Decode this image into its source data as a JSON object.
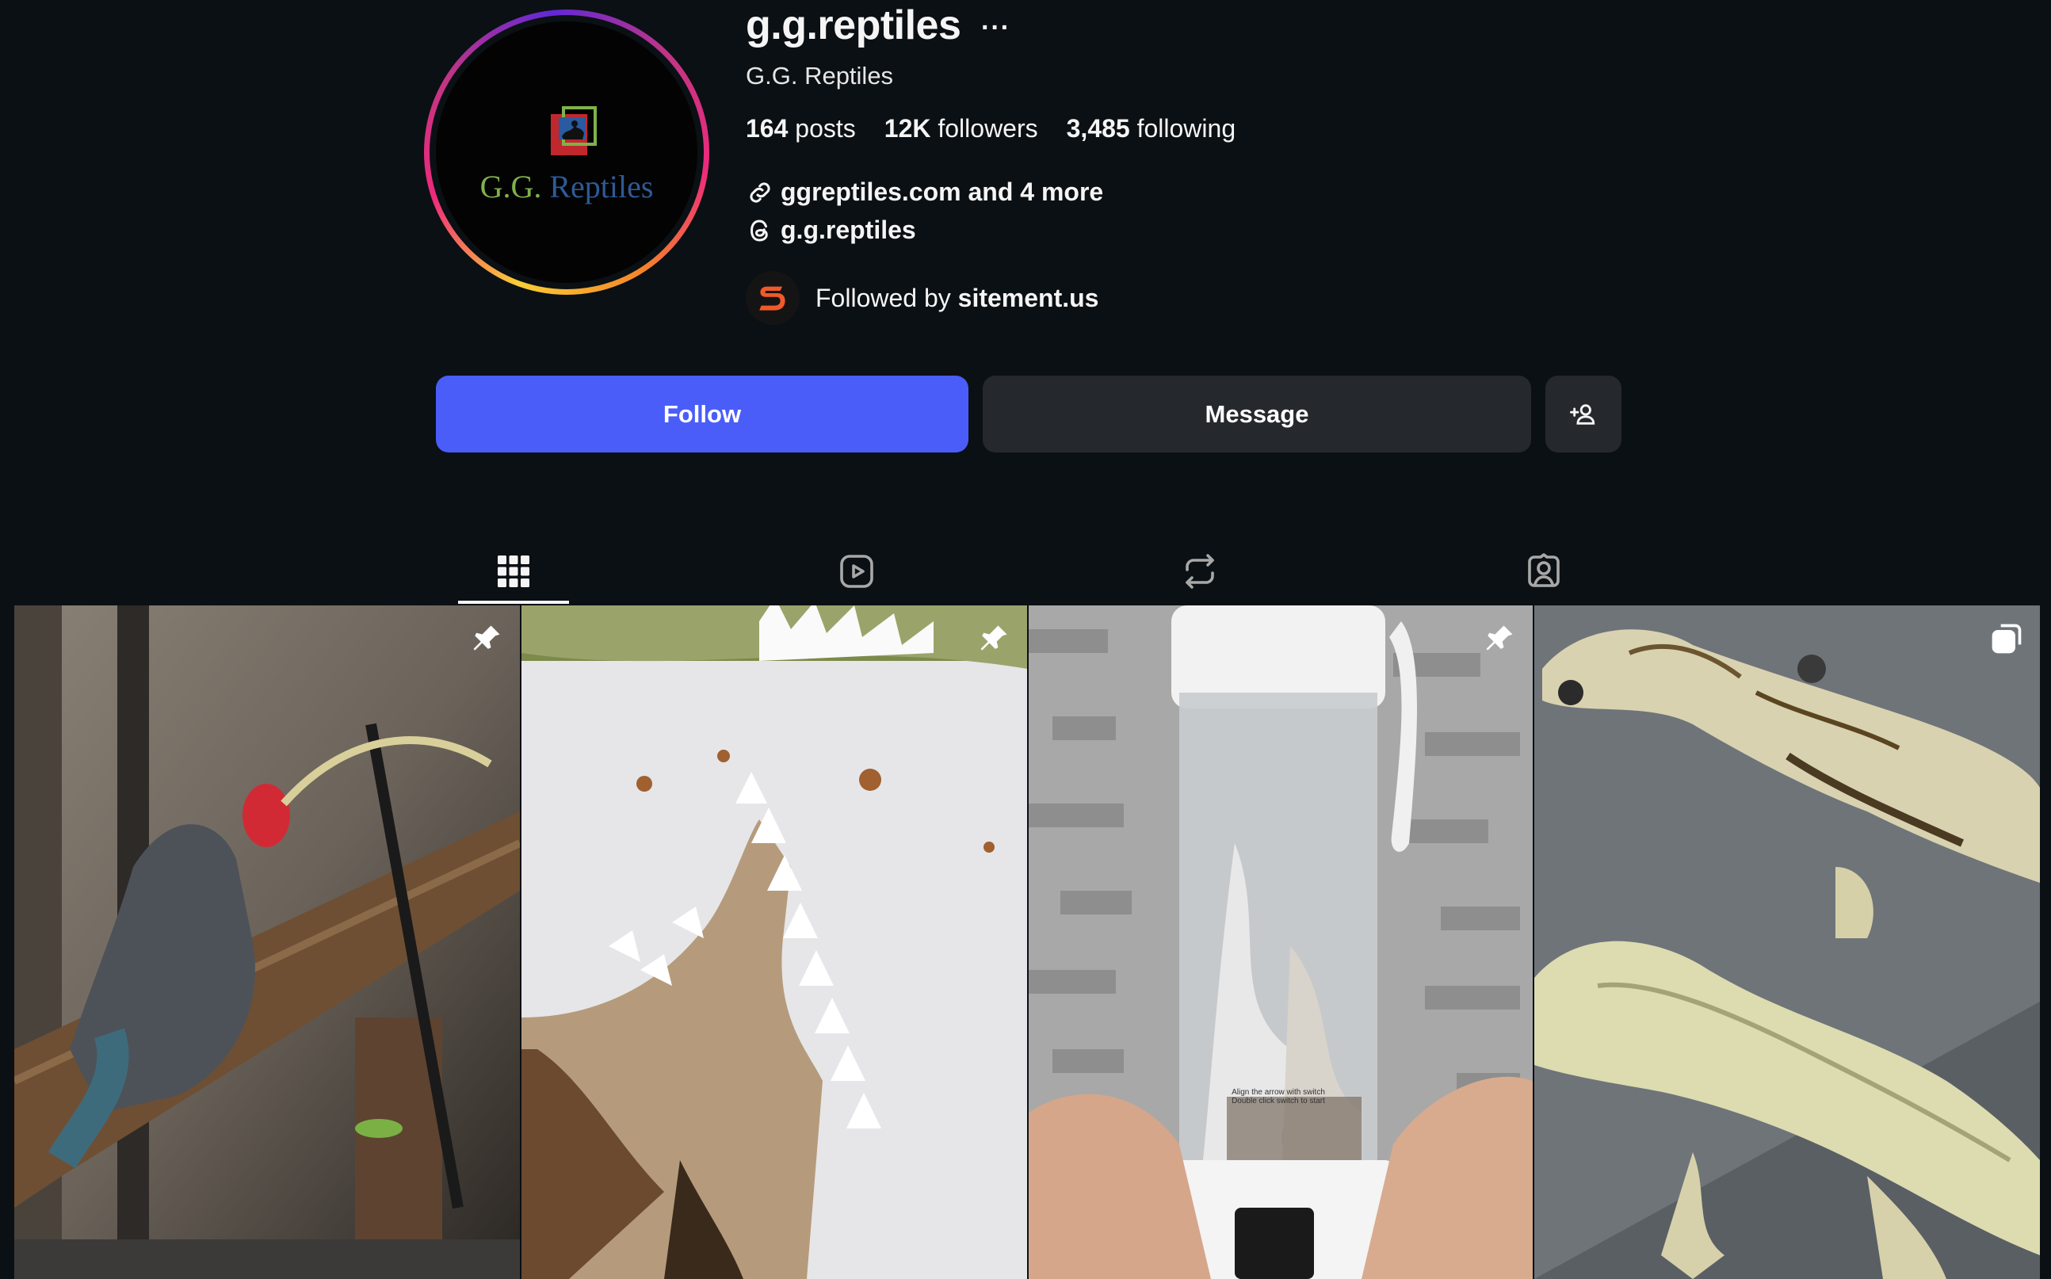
{
  "profile": {
    "username": "g.g.reptiles",
    "more_label": "···",
    "full_name": "G.G. Reptiles",
    "avatar_logo_text_1": "G.G.",
    "avatar_logo_text_2": "Reptiles",
    "stats": [
      {
        "value": "164",
        "label": "posts"
      },
      {
        "value": "12K",
        "label": "followers"
      },
      {
        "value": "3,485",
        "label": "following"
      }
    ],
    "website": "ggreptiles.com and 4 more",
    "threads_handle": "g.g.reptiles",
    "followed_by_prefix": "Followed by",
    "followed_by_user": "sitement.us"
  },
  "actions": {
    "follow_label": "Follow",
    "message_label": "Message",
    "add_icon": "add-person-icon"
  },
  "tabs": [
    {
      "icon": "grid-icon",
      "active": true
    },
    {
      "icon": "reels-icon",
      "active": false
    },
    {
      "icon": "reposts-icon",
      "active": false
    },
    {
      "icon": "tagged-icon",
      "active": false
    }
  ],
  "posts": [
    {
      "subject": "lizard drinking from tweezers",
      "badge": "pin-icon"
    },
    {
      "subject": "white reptile skin closeup",
      "badge": "pin-icon"
    },
    {
      "subject": "blender bottle",
      "badge": "pin-icon",
      "caption_line_1": "Align the arrow with switch",
      "caption_line_2": "Double click switch to start"
    },
    {
      "subject": "crested geckos",
      "badge": "carousel-icon"
    }
  ],
  "colors": {
    "background": "#0b1014",
    "follow_button": "#4a5df9",
    "secondary_button": "#25292e",
    "text": "#f5f5f5"
  }
}
